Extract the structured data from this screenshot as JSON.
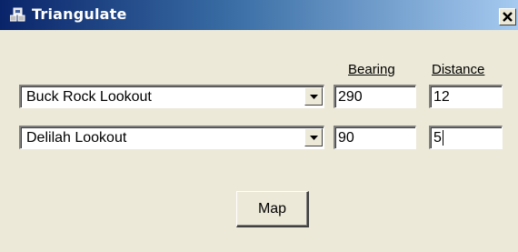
{
  "window": {
    "title": "Triangulate",
    "icon": "triangulate-app-icon",
    "close_icon": "close-icon"
  },
  "headers": {
    "bearing": "Bearing",
    "distance": "Distance"
  },
  "rows": [
    {
      "location": "Buck Rock Lookout",
      "bearing": "290",
      "distance": "12"
    },
    {
      "location": "Delilah Lookout",
      "bearing": "90",
      "distance": "5"
    }
  ],
  "map_button": {
    "label": "Map"
  },
  "colors": {
    "titlebar_start": "#0a246a",
    "titlebar_end": "#a6caf0",
    "dialog_bg": "#ECE9D8"
  }
}
